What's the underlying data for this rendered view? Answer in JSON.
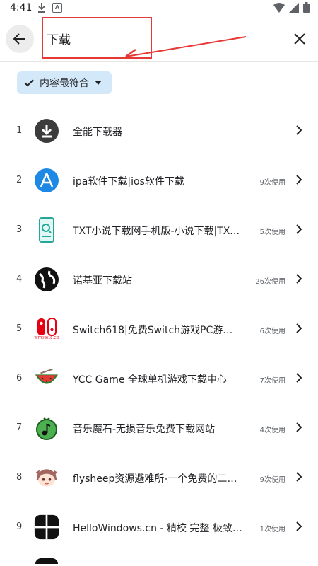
{
  "status_bar": {
    "time": "4:41"
  },
  "search": {
    "query": "下载"
  },
  "filter": {
    "chip_label": "内容最符合"
  },
  "results": [
    {
      "rank": "1",
      "title": "全能下载器",
      "uses": "",
      "icon": "download-icon"
    },
    {
      "rank": "2",
      "title": "ipa软件下载|ios软件下载",
      "uses": "9次使用",
      "icon": "app-store-icon"
    },
    {
      "rank": "3",
      "title": "TXT小说下载网手机版-小说下载|TXT...",
      "uses": "5次使用",
      "icon": "phone-search-icon"
    },
    {
      "rank": "4",
      "title": "诺基亚下载站",
      "uses": "26次使用",
      "icon": "globe-icon"
    },
    {
      "rank": "5",
      "title": "Switch618|免费Switch游戏PC游戏下...",
      "uses": "6次使用",
      "icon": "switch-logo-icon"
    },
    {
      "rank": "6",
      "title": "YCC Game 全球单机游戏下载中心",
      "uses": "7次使用",
      "icon": "watermelon-icon"
    },
    {
      "rank": "7",
      "title": "音乐魔石-无损音乐免费下载网站",
      "uses": "4次使用",
      "icon": "music-note-icon"
    },
    {
      "rank": "8",
      "title": "flysheep资源避难所-一个免费的二次...",
      "uses": "9次使用",
      "icon": "anime-avatar-icon"
    },
    {
      "rank": "9",
      "title": "HelloWindows.cn - 精校 完整 极致 Wi...",
      "uses": "1次使用",
      "icon": "windows-icon"
    }
  ],
  "icon_labels": {
    "switch_caption": "WITCH618.CO"
  },
  "colors": {
    "chip_bg": "#d3e8f8",
    "annotation_red": "#e53935",
    "app_store_blue": "#1e88e5",
    "switch_red": "#e60012",
    "music_green": "#4caf50"
  }
}
